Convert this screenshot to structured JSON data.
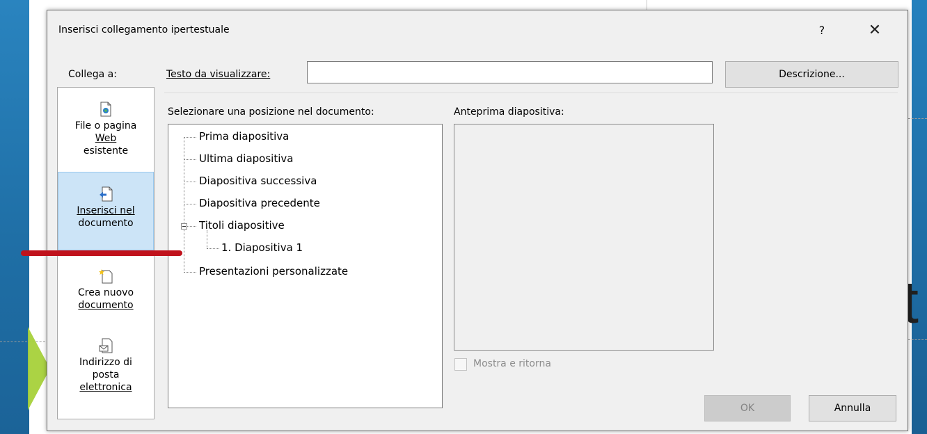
{
  "dialog": {
    "title": "Inserisci collegamento ipertestuale",
    "help": "?",
    "close": "✕"
  },
  "link_to": {
    "label": "Collega a:",
    "items": [
      {
        "l1": "File o pagina",
        "l2": "Web",
        "l3": "esistente",
        "icon": "existing-file-icon"
      },
      {
        "l1": "Inserisci nel",
        "l2": "documento",
        "icon": "place-in-document-icon",
        "selected": true
      },
      {
        "l1": "Crea nuovo",
        "l2": "documento",
        "icon": "new-document-icon"
      },
      {
        "l1": "Indirizzo di",
        "l2": "posta",
        "l3": "elettronica",
        "icon": "email-address-icon"
      }
    ]
  },
  "text_to_display": {
    "label": "Testo da visualizzare:",
    "value": ""
  },
  "screentip_button": "Descrizione...",
  "select_place": {
    "label": "Selezionare una posizione nel documento:",
    "items": [
      "Prima diapositiva",
      "Ultima diapositiva",
      "Diapositiva successiva",
      "Diapositiva precedente",
      "Titoli diapositive",
      "1. Diapositiva 1",
      "Presentazioni personalizzate"
    ]
  },
  "slide_preview": {
    "label": "Anteprima diapositiva:"
  },
  "show_and_return": {
    "label": "Mostra e ritorna",
    "checked": false,
    "enabled": false
  },
  "buttons": {
    "ok": "OK",
    "cancel": "Annulla"
  },
  "background": {
    "slide_letter": "t"
  },
  "colors": {
    "accent_red": "#c0121c",
    "selection": "#cce4f7"
  }
}
